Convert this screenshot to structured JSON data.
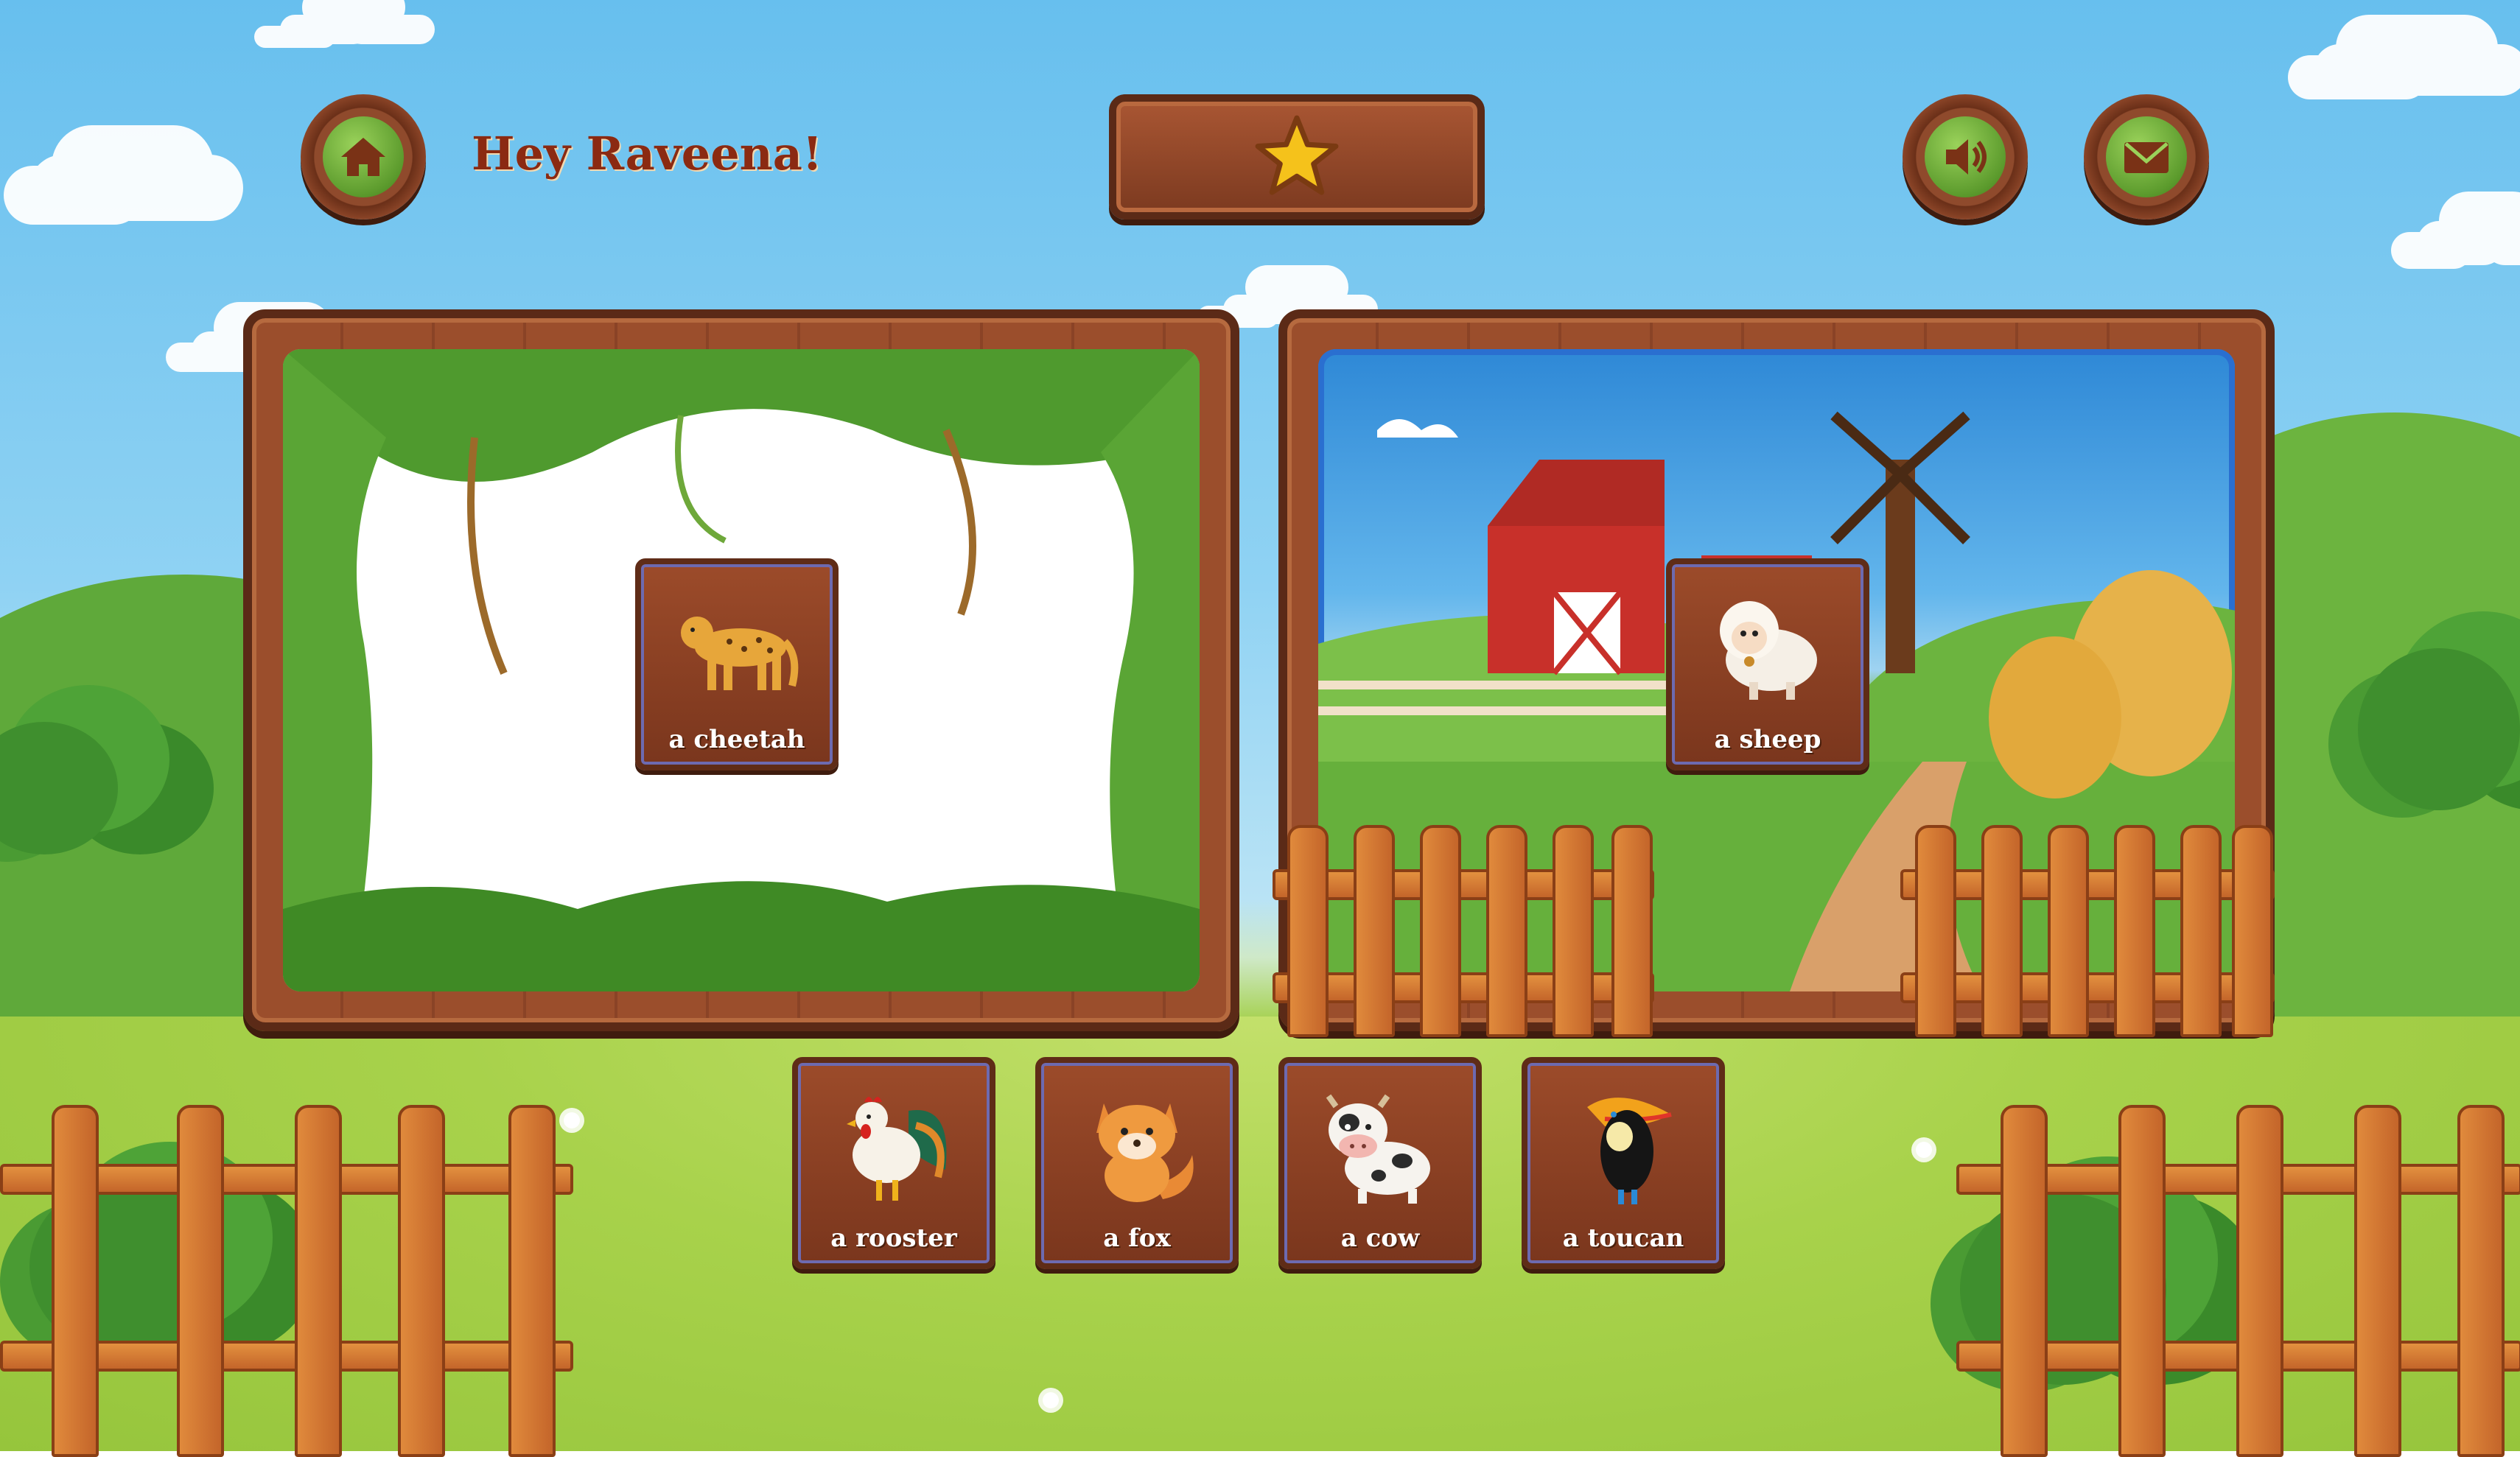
{
  "header": {
    "greeting": "Hey Raveena!",
    "home_icon": "home-icon",
    "star_icon": "star-icon",
    "sound_icon": "speaker-icon",
    "mail_icon": "envelope-icon"
  },
  "boards": [
    {
      "scene": "jungle",
      "placed_card": {
        "label": "a cheetah",
        "icon": "cheetah"
      }
    },
    {
      "scene": "farm",
      "placed_card": {
        "label": "a sheep",
        "icon": "sheep"
      }
    }
  ],
  "tray": {
    "cards": [
      {
        "label": "a rooster",
        "icon": "rooster"
      },
      {
        "label": "a fox",
        "icon": "fox"
      },
      {
        "label": "a cow",
        "icon": "cow"
      },
      {
        "label": "a toucan",
        "icon": "toucan"
      }
    ]
  },
  "colors": {
    "wood": "#9b4e2c",
    "wood_dark": "#5b2a17",
    "greeting_text": "#8b2a12",
    "button_green": "#5c9b2d",
    "sky": "#8fd2f3",
    "grass": "#a8d24b"
  }
}
